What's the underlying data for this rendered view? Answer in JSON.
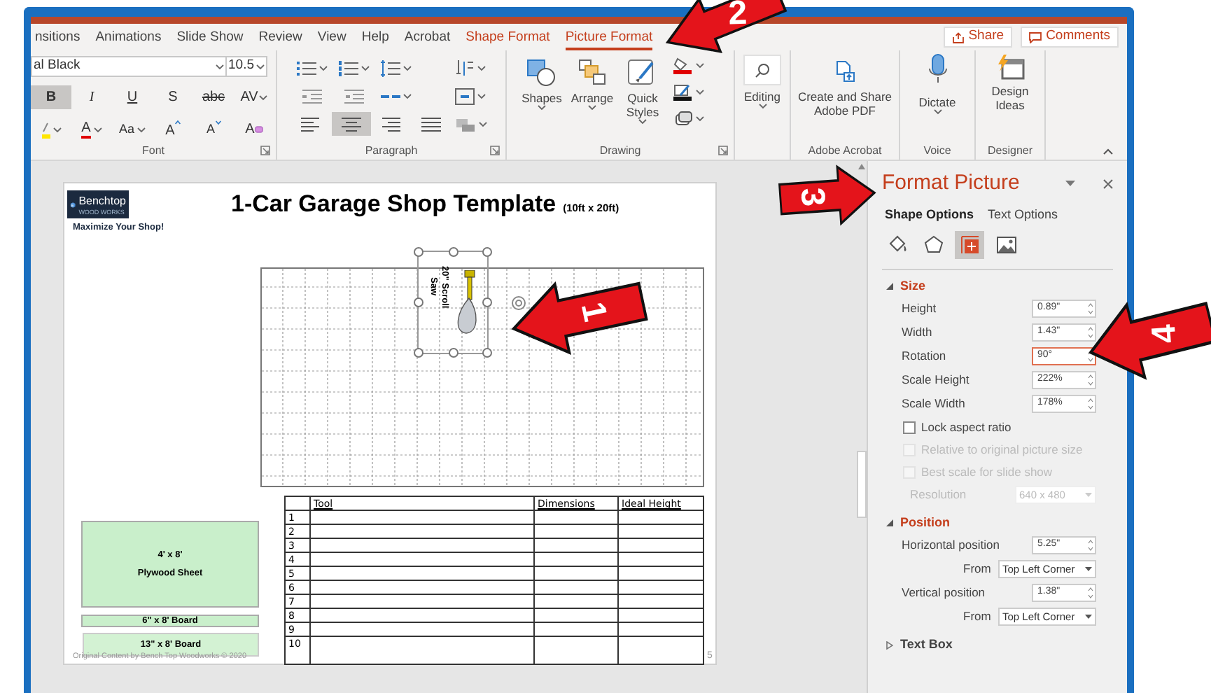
{
  "tabs": [
    {
      "label": "nsitions",
      "kind": "normal",
      "selected": false
    },
    {
      "label": "Animations",
      "kind": "normal",
      "selected": false
    },
    {
      "label": "Slide Show",
      "kind": "normal",
      "selected": false
    },
    {
      "label": "Review",
      "kind": "normal",
      "selected": false
    },
    {
      "label": "View",
      "kind": "normal",
      "selected": false
    },
    {
      "label": "Help",
      "kind": "normal",
      "selected": false
    },
    {
      "label": "Acrobat",
      "kind": "normal",
      "selected": false
    },
    {
      "label": "Shape Format",
      "kind": "contextual",
      "selected": false
    },
    {
      "label": "Picture Format",
      "kind": "contextual",
      "selected": true
    }
  ],
  "header_buttons": [
    {
      "label": "Share",
      "kind": "share"
    },
    {
      "label": "Comments",
      "kind": "comments"
    }
  ],
  "ribbon": {
    "font": {
      "name": "al Black",
      "size": "10.5",
      "group_label": "Font",
      "style_buttons": [
        {
          "label": "B",
          "kind": "bold",
          "selected": true
        },
        {
          "label": "I",
          "kind": "italic",
          "selected": false
        },
        {
          "label": "U",
          "kind": "underline",
          "selected": false
        },
        {
          "label": "S",
          "kind": "shadow",
          "selected": false
        },
        {
          "label": "abc",
          "kind": "strike",
          "selected": false
        },
        {
          "label": "AV",
          "kind": "spacing",
          "selected": false
        }
      ],
      "format_buttons": [
        {
          "kind": "highlight"
        },
        {
          "kind": "font-color",
          "label": "A"
        },
        {
          "kind": "case",
          "label": "Aa"
        },
        {
          "kind": "grow",
          "label": "A"
        },
        {
          "kind": "shrink",
          "label": "A"
        },
        {
          "kind": "clear",
          "label": "A"
        }
      ]
    },
    "paragraph": {
      "group_label": "Paragraph",
      "rows": [
        [
          {
            "kind": "bullets"
          },
          {
            "kind": "numbering"
          },
          {
            "kind": "line-spacing"
          },
          {
            "kind": "text-direction"
          }
        ],
        [
          {
            "kind": "decrease-indent"
          },
          {
            "kind": "increase-indent"
          },
          {
            "kind": "columns"
          },
          {
            "kind": "align-text"
          }
        ]
      ],
      "alignment": [
        {
          "kind": "left",
          "selected": false
        },
        {
          "kind": "center",
          "selected": true
        },
        {
          "kind": "right",
          "selected": false
        },
        {
          "kind": "justify",
          "selected": false
        },
        {
          "kind": "smartart",
          "selected": false
        }
      ]
    },
    "drawing": {
      "group_label": "Drawing",
      "buttons": [
        {
          "label": "Shapes",
          "kind": "shapes"
        },
        {
          "label": "Arrange",
          "kind": "arrange"
        },
        {
          "label": "Quick Styles",
          "kind": "quick-styles"
        }
      ]
    },
    "editing": {
      "label": "Editing"
    },
    "acrobat": {
      "label": "Create and Share Adobe PDF",
      "group_label": "Adobe Acrobat"
    },
    "voice": {
      "label": "Dictate",
      "group_label": "Voice"
    },
    "designer": {
      "label": "Design Ideas",
      "group_label": "Designer"
    }
  },
  "slide": {
    "logo": {
      "brand": "Benchtop",
      "sub": "WOOD WORKS",
      "tagline": "Maximize Your Shop!"
    },
    "title": "1-Car Garage Shop Template",
    "subtitle": "(10ft x 20ft)",
    "picture_label": "20\" Scroll Saw",
    "table": {
      "columns": [
        "Tool",
        "Dimensions",
        "Ideal Height"
      ],
      "rows": [
        "1",
        "2",
        "3",
        "4",
        "5",
        "6",
        "7",
        "8",
        "9",
        "10"
      ]
    },
    "materials": [
      {
        "kind": "sheet",
        "lines": [
          "4' x 8'",
          "Plywood Sheet"
        ]
      },
      {
        "kind": "thin-board",
        "lines": [
          "6\" x 8' Board"
        ]
      },
      {
        "kind": "board",
        "lines": [
          "13\" x 8' Board"
        ]
      }
    ],
    "footer": "Original Content by Bench Top Woodworks © 2020",
    "page_number": "5"
  },
  "pane": {
    "title": "Format Picture",
    "tabs": [
      {
        "label": "Shape Options",
        "selected": true
      },
      {
        "label": "Text Options",
        "selected": false
      }
    ],
    "icon_tabs": [
      {
        "kind": "fill",
        "selected": false
      },
      {
        "kind": "effects",
        "selected": false
      },
      {
        "kind": "size",
        "selected": true
      },
      {
        "kind": "picture",
        "selected": false
      }
    ],
    "sections": [
      {
        "title": "Size",
        "expanded": true,
        "items": [
          {
            "kind": "spin",
            "label": "Height",
            "value": "0.89\"",
            "focused": false
          },
          {
            "kind": "spin",
            "label": "Width",
            "value": "1.43\"",
            "focused": false
          },
          {
            "kind": "spin",
            "label": "Rotation",
            "value": "90°",
            "focused": true
          },
          {
            "kind": "spin",
            "label": "Scale Height",
            "value": "222%",
            "focused": false
          },
          {
            "kind": "spin",
            "label": "Scale Width",
            "value": "178%",
            "focused": false
          },
          {
            "kind": "checkbox",
            "label": "Lock aspect ratio",
            "checked": false,
            "disabled": false
          },
          {
            "kind": "checkbox",
            "label": "Relative to original picture size",
            "checked": false,
            "disabled": true
          },
          {
            "kind": "checkbox",
            "label": "Best scale for slide show",
            "checked": false,
            "disabled": true
          },
          {
            "kind": "dropdown",
            "label": "Resolution",
            "value": "640 x 480",
            "disabled": true
          }
        ]
      },
      {
        "title": "Position",
        "expanded": true,
        "items": [
          {
            "kind": "spin",
            "label": "Horizontal position",
            "value": "5.25\"",
            "focused": false
          },
          {
            "kind": "from",
            "label": "From",
            "value": "Top Left Corner",
            "disabled": false
          },
          {
            "kind": "spin",
            "label": "Vertical position",
            "value": "1.38\"",
            "focused": false
          },
          {
            "kind": "from",
            "label": "From",
            "value": "Top Left Corner",
            "disabled": false
          }
        ]
      },
      {
        "title": "Text Box",
        "expanded": false
      }
    ]
  },
  "annotations": [
    {
      "number": "1"
    },
    {
      "number": "2"
    },
    {
      "number": "3"
    },
    {
      "number": "4"
    }
  ]
}
